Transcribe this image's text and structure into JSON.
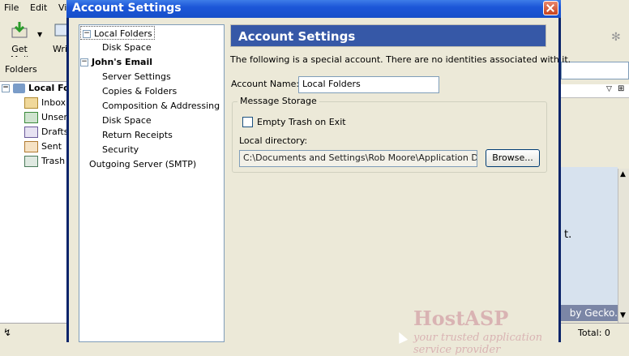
{
  "background_app": {
    "menu": [
      "File",
      "Edit",
      "Vi"
    ],
    "toolbar": {
      "get_mail": "Get Mail",
      "write": "Wri"
    },
    "folders_header": "Folders",
    "folders": [
      {
        "label": "Local Fol",
        "icon": "computer-icon"
      },
      {
        "label": "Inbox",
        "icon": "inbox-icon"
      },
      {
        "label": "Unsent",
        "icon": "unsent-icon"
      },
      {
        "label": "Drafts",
        "icon": "drafts-icon"
      },
      {
        "label": "Sent",
        "icon": "sent-icon"
      },
      {
        "label": "Trash",
        "icon": "trash-icon"
      }
    ],
    "right_text": "t.",
    "by_gecko": "by Gecko.",
    "total": "Total: 0"
  },
  "dialog": {
    "title": "Account Settings",
    "tree": {
      "local_folders": "Local Folders",
      "disk_space_1": "Disk Space",
      "account": "John's Email",
      "server_settings": "Server Settings",
      "copies_folders": "Copies & Folders",
      "composition": "Composition & Addressing",
      "disk_space_2": "Disk Space",
      "return_receipts": "Return Receipts",
      "security": "Security",
      "outgoing": "Outgoing Server (SMTP)"
    },
    "panel": {
      "title": "Account Settings",
      "description": "The following is a special account. There are no identities associated with it.",
      "account_name_label": "Account Name:",
      "account_name_value": "Local Folders",
      "storage_legend": "Message Storage",
      "empty_trash_label": "Empty Trash on Exit",
      "empty_trash_checked": false,
      "local_dir_label": "Local directory:",
      "local_dir_value": "C:\\Documents and Settings\\Rob Moore\\Application Data\\Thu",
      "browse_label": "Browse..."
    },
    "watermark": {
      "brand": "HostASP",
      "tagline": "your trusted application service provider"
    }
  }
}
